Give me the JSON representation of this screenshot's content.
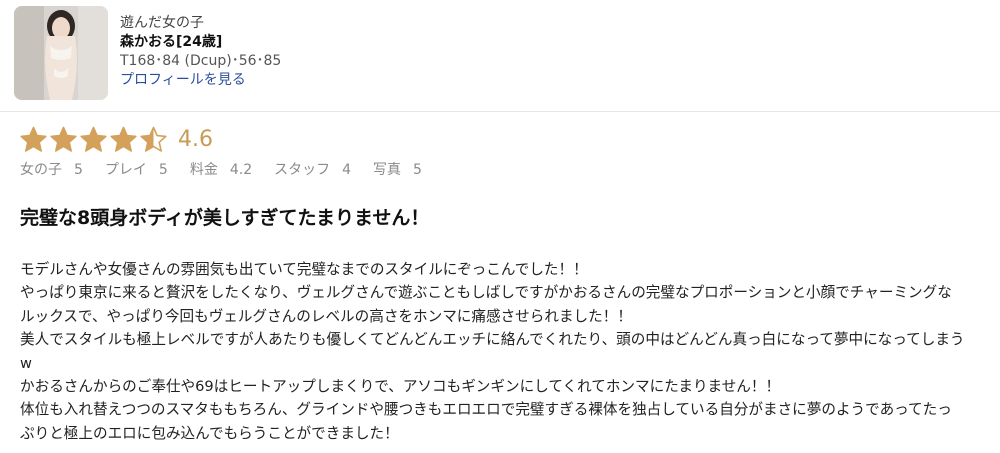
{
  "profile": {
    "label": "遊んだ女の子",
    "name": "森かおる[24歳]",
    "stats": "T168･84 (Dcup)･56･85",
    "link": "プロフィールを見る"
  },
  "rating": {
    "stars": 4.5,
    "score": "4.6",
    "star_color": "#d4a15b",
    "categories": [
      {
        "label": "女の子",
        "value": "5"
      },
      {
        "label": "プレイ",
        "value": "5"
      },
      {
        "label": "料金",
        "value": "4.2"
      },
      {
        "label": "スタッフ",
        "value": "4"
      },
      {
        "label": "写真",
        "value": "5"
      }
    ]
  },
  "review": {
    "title": "完璧な8頭身ボディが美しすぎてたまりません！",
    "lines": [
      "モデルさんや女優さんの雰囲気も出ていて完璧なまでのスタイルにぞっこんでした！！",
      "やっぱり東京に来ると贅沢をしたくなり、ヴェルグさんで遊ぶこともしばしですがかおるさんの完璧なプロポーションと小顔でチャーミングな",
      "ルックスで、やっぱり今回もヴェルグさんのレベルの高さをホンマに痛感させられました！！",
      "美人でスタイルも極上レベルですが人あたりも優しくてどんどんエッチに絡んでくれたり、頭の中はどんどん真っ白になって夢中になってしまう",
      "w",
      "かおるさんからのご奉仕や69はヒートアップしまくりで、アソコもギンギンにしてくれてホンマにたまりません！！",
      "体位も入れ替えつつのスマタももちろん、グラインドや腰つきもエロエロで完璧すぎる裸体を独占している自分がまさに夢のようであってたっ",
      "ぷりと極上のエロに包み込んでもらうことができました！"
    ]
  }
}
